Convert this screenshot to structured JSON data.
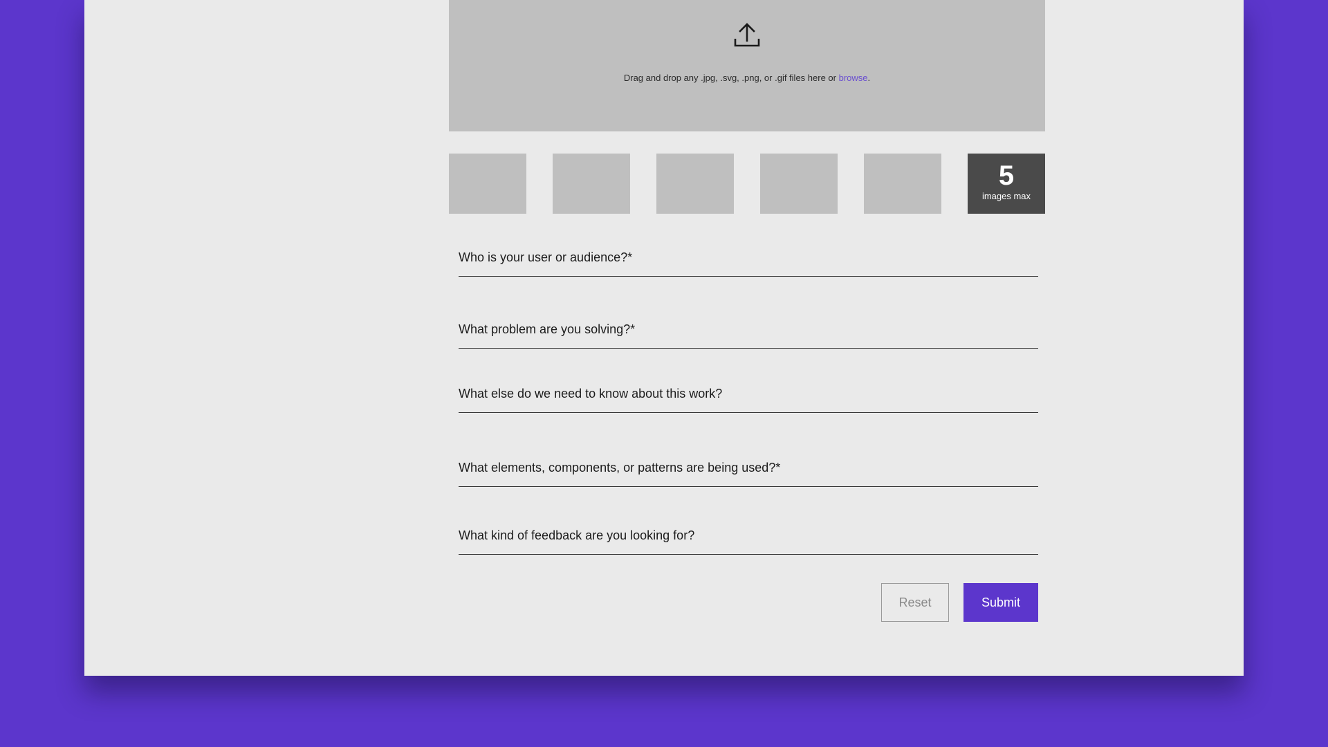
{
  "upload": {
    "icon": "upload-icon",
    "drop_text": "Drag and drop any .jpg, .svg, .png, or .gif files here or ",
    "browse_label": "browse",
    "suffix": "."
  },
  "thumbnails": {
    "max_number": "5",
    "max_label": "images max"
  },
  "form": {
    "fields": [
      {
        "label": "Who is your user or audience?*"
      },
      {
        "label": "What problem are you solving?*"
      },
      {
        "label": "What else do we need to know about this work?"
      },
      {
        "label": "What elements, components, or patterns are being used?*"
      },
      {
        "label": "What kind of feedback are you looking for?"
      }
    ],
    "reset_label": "Reset",
    "submit_label": "Submit"
  },
  "colors": {
    "background": "#5c36cc",
    "card": "#eaeaea",
    "accent": "#5c36cc",
    "link": "#6a4fd0",
    "placeholder": "#bfbfbf",
    "max_box": "#4a4a4a"
  }
}
